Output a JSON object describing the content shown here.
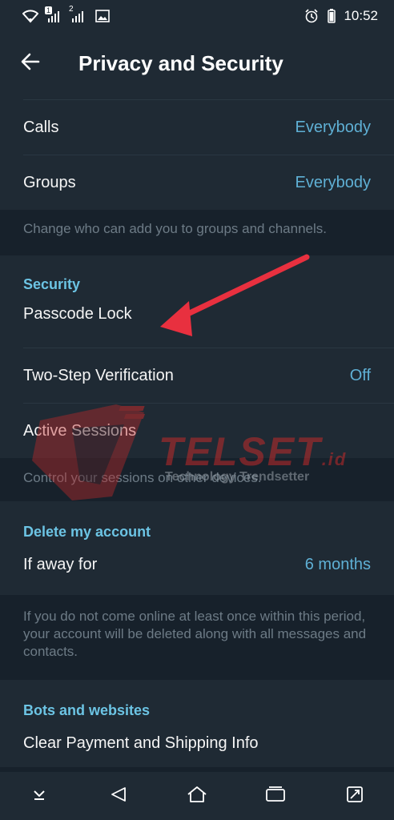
{
  "status_bar": {
    "sim1": "1",
    "sim2": "2",
    "time": "10:52",
    "icons": [
      "wifi-icon",
      "signal-icon",
      "signal-icon",
      "image-icon",
      "alarm-icon",
      "battery-icon"
    ]
  },
  "app_bar": {
    "title": "Privacy and Security",
    "back_icon": "arrow-left-icon"
  },
  "partial_row_top": {},
  "calls": {
    "label": "Calls",
    "value": "Everybody"
  },
  "groups": {
    "label": "Groups",
    "value": "Everybody"
  },
  "groups_info": "Change who can add you to groups and channels.",
  "security": {
    "header": "Security",
    "passcode": {
      "label": "Passcode Lock"
    },
    "two_step": {
      "label": "Two-Step Verification",
      "value": "Off"
    },
    "sessions": {
      "label": "Active Sessions"
    },
    "info": "Control your sessions on other devices."
  },
  "delete_account": {
    "header": "Delete my account",
    "away": {
      "label": "If away for",
      "value": "6 months"
    },
    "info": "If you do not come online at least once within this period, your account will be deleted along with all messages and contacts."
  },
  "bots": {
    "header": "Bots and websites",
    "clear_payment": {
      "label": "Clear Payment and Shipping Info"
    }
  },
  "watermark": {
    "brand": "TELSET",
    "suffix": ".id",
    "tagline": "Technology Trendsetter"
  },
  "nav_bar": {
    "icons": [
      "chevron-down-icon",
      "back-triangle-icon",
      "home-icon",
      "recents-icon",
      "screenshot-icon"
    ]
  },
  "colors": {
    "background": "#17212b",
    "card": "#1f2a34",
    "accent": "#5fb0d5",
    "header": "#6cc4e4",
    "annotation_arrow": "#e8303f"
  }
}
